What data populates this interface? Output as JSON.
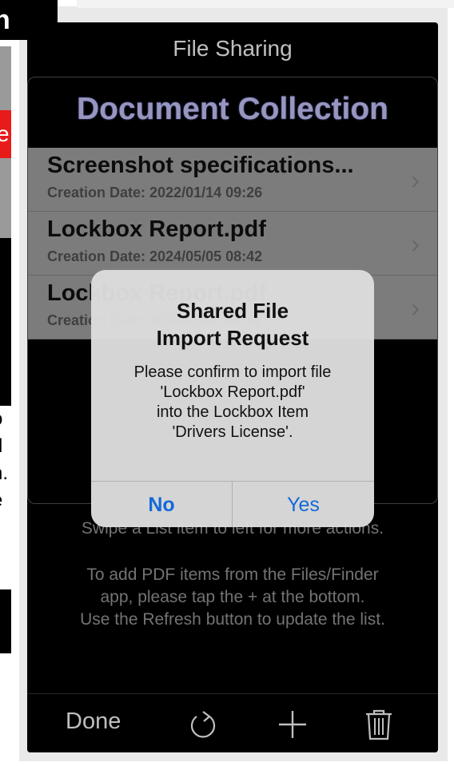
{
  "background": {
    "left_fragment_top": "n",
    "left_fragment_red": "e",
    "left_fragment_lines": [
      "o",
      "",
      "d",
      "n.",
      "e"
    ]
  },
  "nav": {
    "title": "File Sharing"
  },
  "collection": {
    "title": "Document Collection"
  },
  "documents": [
    {
      "name": "Screenshot specifications...",
      "date": "Creation Date: 2022/01/14 09:26"
    },
    {
      "name": "Lockbox Report.pdf",
      "date": "Creation Date: 2024/05/05 08:42"
    },
    {
      "name": "Lockbox Report.pdf",
      "date": "Creation Date: 2024/05/05 08:42"
    }
  ],
  "help": {
    "line1": "Swipe a List item to left for more actions.",
    "line2": "To add PDF items from the Files/Finder",
    "line3": "app, please tap the + at the bottom.",
    "line4": "Use the Refresh button to update the list."
  },
  "toolbar": {
    "done_label": "Done",
    "icons": [
      "refresh-icon",
      "plus-icon",
      "trash-icon"
    ]
  },
  "alert": {
    "title_line1": "Shared File",
    "title_line2": "Import Request",
    "msg_line1": "Please confirm to import file",
    "msg_line2": "'Lockbox Report.pdf'",
    "msg_line3": "into the Lockbox Item",
    "msg_line4": "'Drivers License'.",
    "no_label": "No",
    "yes_label": "Yes"
  },
  "colors": {
    "accent": "#1469d8",
    "collection_title": "#c8c8ff",
    "row_bg": "#a6a6a6"
  }
}
